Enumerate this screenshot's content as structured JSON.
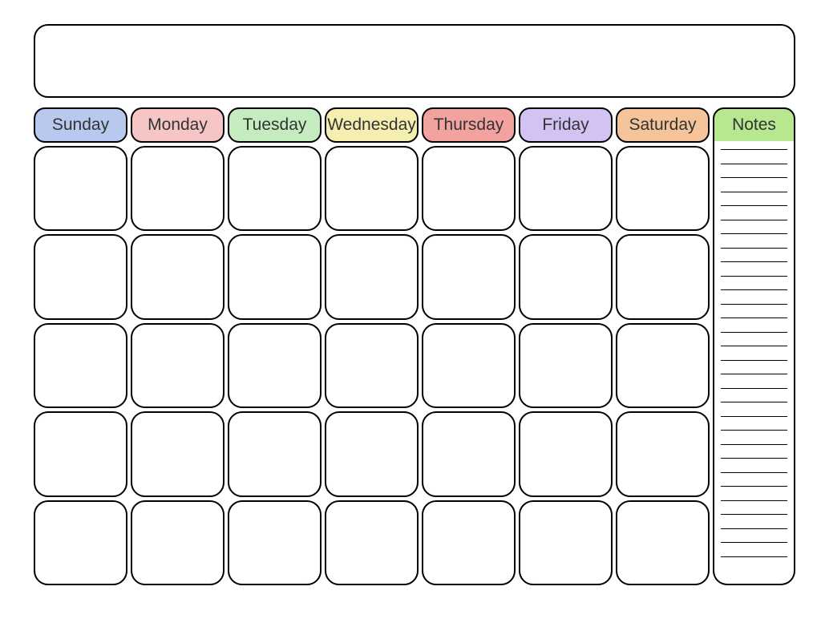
{
  "calendar": {
    "title": "",
    "headers": [
      {
        "label": "Sunday",
        "color": "#b8c8ef"
      },
      {
        "label": "Monday",
        "color": "#f6c5c5"
      },
      {
        "label": "Tuesday",
        "color": "#c4ecc0"
      },
      {
        "label": "Wednesday",
        "color": "#f4efb0"
      },
      {
        "label": "Thursday",
        "color": "#f2a3a0"
      },
      {
        "label": "Friday",
        "color": "#d3c3f2"
      },
      {
        "label": "Saturday",
        "color": "#f5c49a"
      },
      {
        "label": "Notes",
        "color": "#b7e78f"
      }
    ],
    "rows": 5,
    "cols": 7,
    "notes_lines": 30
  }
}
